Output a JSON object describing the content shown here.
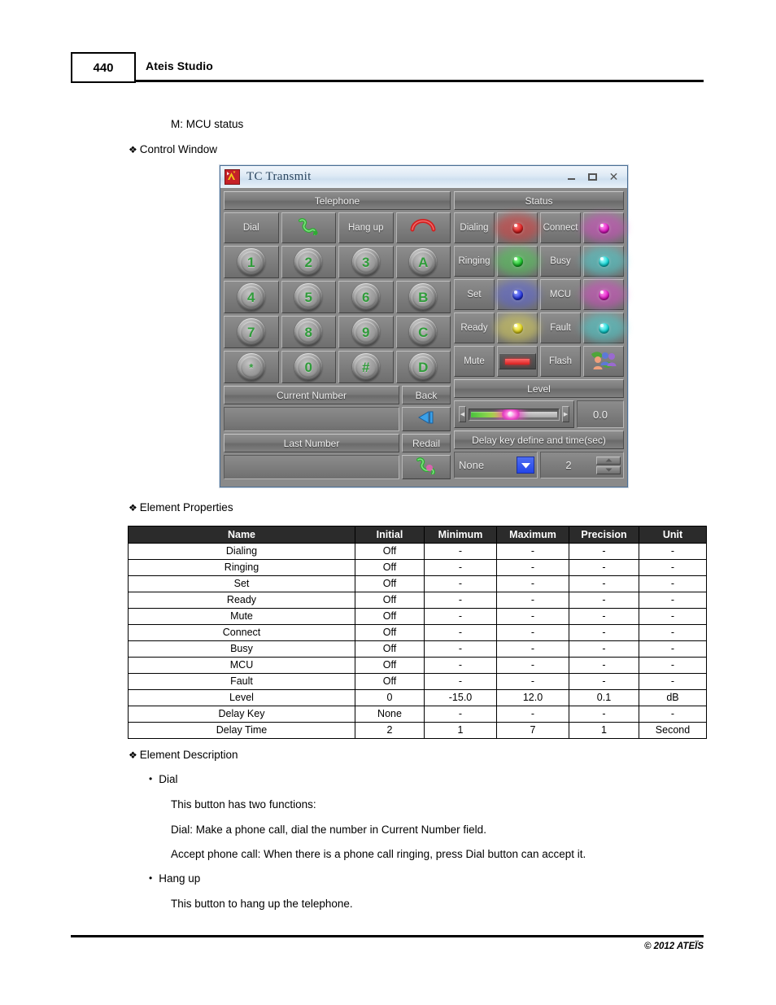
{
  "page": {
    "number": "440",
    "header_title": "Ateis Studio",
    "footer": "© 2012 ATEÏS"
  },
  "body_lines": {
    "mcu_status": "M: MCU status",
    "section_control_window": "Control Window",
    "section_element_properties": "Element Properties",
    "section_element_description": "Element Description",
    "bullet_dial": "Dial",
    "dial_desc_1": "This button has two functions:",
    "dial_desc_2": "Dial: Make a phone call, dial the number in Current Number field.",
    "dial_desc_3": "Accept phone call: When there is a phone call ringing, press Dial button can accept it.",
    "bullet_hangup": "Hang up",
    "hangup_desc_1": "This button to hang up the telephone."
  },
  "dialog": {
    "title": "TC Transmit",
    "titlebar_buttons": {
      "minimize": "minimize-icon",
      "maximize": "maximize-icon",
      "close": "close-icon"
    },
    "telephone": {
      "header": "Telephone",
      "dial_label": "Dial",
      "dial_icon": "green-handset-icon",
      "hangup_label": "Hang up",
      "hangup_icon": "red-handset-down-icon",
      "keys": [
        "1",
        "2",
        "3",
        "A",
        "4",
        "5",
        "6",
        "B",
        "7",
        "8",
        "9",
        "C",
        "*",
        "0",
        "#",
        "D"
      ],
      "current_number_label": "Current Number",
      "current_number_value": "",
      "back_label": "Back",
      "back_icon": "back-arrow-icon",
      "last_number_label": "Last Number",
      "last_number_value": "",
      "redial_label": "Redail",
      "redial_icon": "redial-handset-icon"
    },
    "status": {
      "header": "Status",
      "items": [
        {
          "label": "Dialing",
          "led": "#e01f1f",
          "glow": "#d93a3a"
        },
        {
          "label": "Connect",
          "led": "#e516c8",
          "glow": "#d44bc2"
        },
        {
          "label": "Ringing",
          "led": "#19c42a",
          "glow": "#4fca55"
        },
        {
          "label": "Busy",
          "led": "#0ed8d8",
          "glow": "#4bd2d2"
        },
        {
          "label": "Set",
          "led": "#2434e0",
          "glow": "#5a63d6"
        },
        {
          "label": "MCU",
          "led": "#e516c8",
          "glow": "#d44bc2"
        },
        {
          "label": "Ready",
          "led": "#e8d91a",
          "glow": "#d9cf57"
        },
        {
          "label": "Fault",
          "led": "#0ed8d8",
          "glow": "#4bd2d2"
        },
        {
          "label": "Mute",
          "led": "#e02020",
          "glow": "#d84343"
        },
        {
          "label": "Flash",
          "led": "#ffffff",
          "glow": "#bdbdbd"
        }
      ],
      "mute_indicator": "red-bar-indicator",
      "flash_icon": "group-people-icon"
    },
    "level": {
      "header": "Level",
      "value": "0.0",
      "slider_percent": 46,
      "left_arrow": "slider-left-arrow",
      "right_arrow": "slider-right-arrow"
    },
    "delay": {
      "header": "Delay key define and time(sec)",
      "key_value": "None",
      "time_value": "2",
      "dropdown_arrow_color": "#2e4ff0"
    }
  },
  "properties_table": {
    "columns": [
      "Name",
      "Initial",
      "Minimum",
      "Maximum",
      "Precision",
      "Unit"
    ],
    "rows": [
      [
        "Dialing",
        "Off",
        "-",
        "-",
        "-",
        "-"
      ],
      [
        "Ringing",
        "Off",
        "-",
        "-",
        "-",
        "-"
      ],
      [
        "Set",
        "Off",
        "-",
        "-",
        "-",
        "-"
      ],
      [
        "Ready",
        "Off",
        "-",
        "-",
        "-",
        "-"
      ],
      [
        "Mute",
        "Off",
        "-",
        "-",
        "-",
        "-"
      ],
      [
        "Connect",
        "Off",
        "-",
        "-",
        "-",
        "-"
      ],
      [
        "Busy",
        "Off",
        "-",
        "-",
        "-",
        "-"
      ],
      [
        "MCU",
        "Off",
        "-",
        "-",
        "-",
        "-"
      ],
      [
        "Fault",
        "Off",
        "-",
        "-",
        "-",
        "-"
      ],
      [
        "Level",
        "0",
        "-15.0",
        "12.0",
        "0.1",
        "dB"
      ],
      [
        "Delay Key",
        "None",
        "-",
        "-",
        "-",
        "-"
      ],
      [
        "Delay Time",
        "2",
        "1",
        "7",
        "1",
        "Second"
      ]
    ]
  }
}
